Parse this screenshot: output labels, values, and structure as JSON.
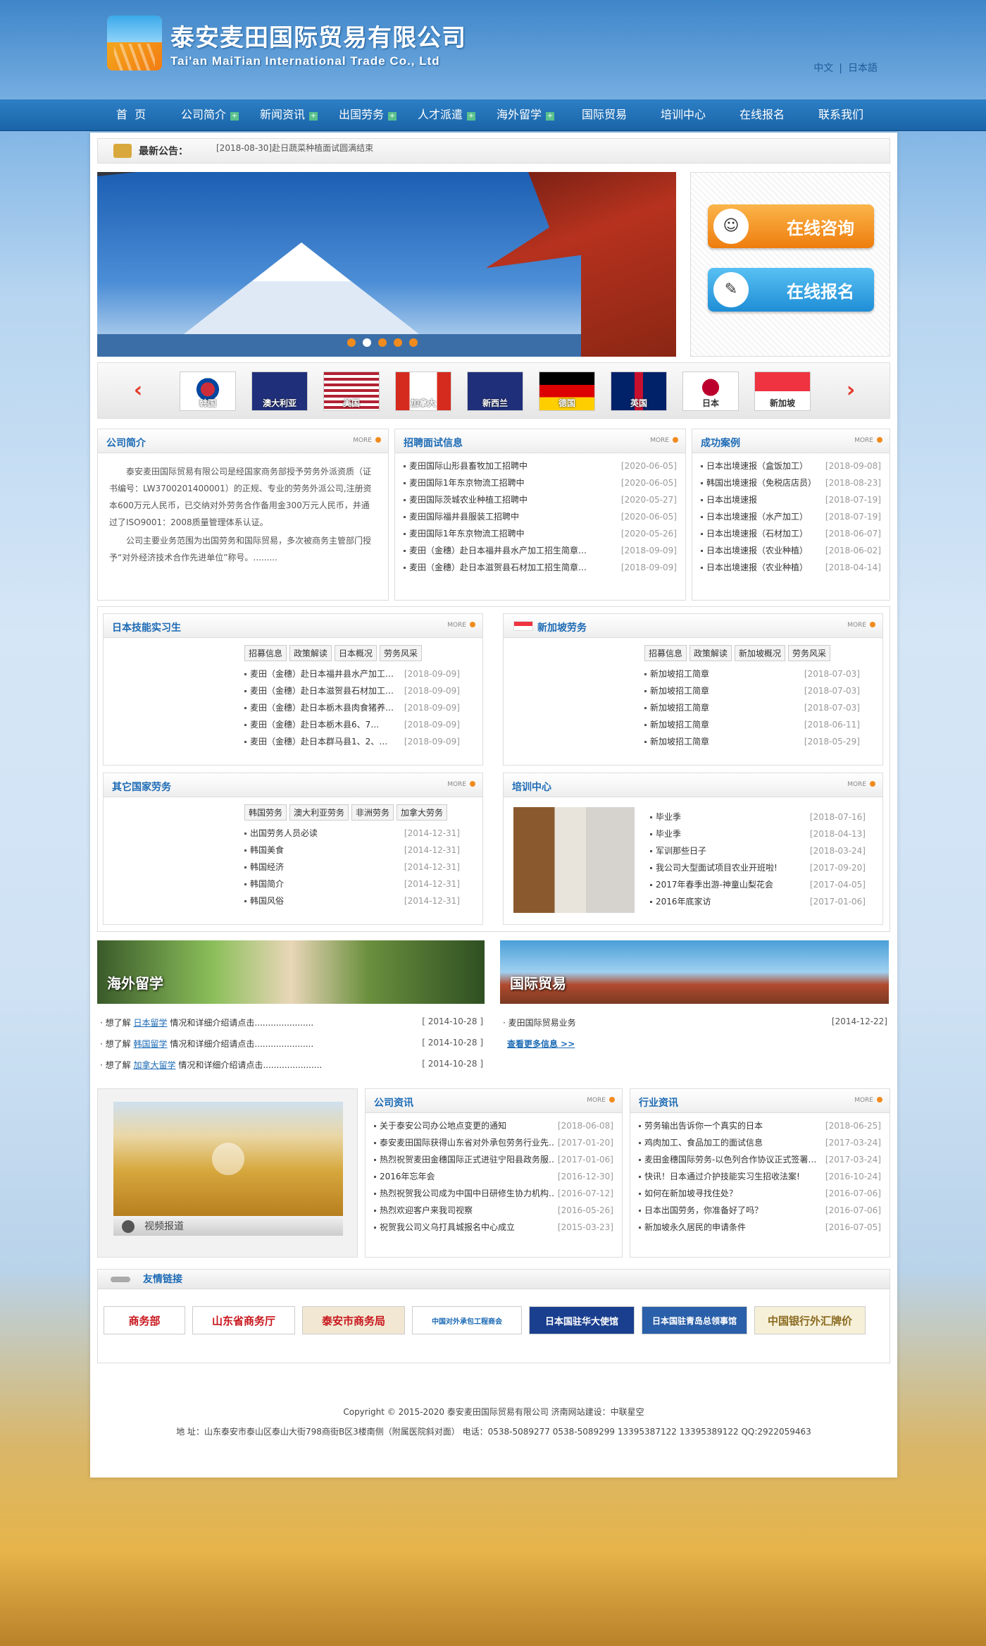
{
  "header": {
    "logo_cn": "泰安麦田国际贸易有限公司",
    "logo_en": "Tai'an MaiTian International Trade Co., Ltd",
    "lang_cn": "中文",
    "lang_sep": "|",
    "lang_jp": "日本語"
  },
  "nav": {
    "items": [
      "首  页",
      "公司简介",
      "新闻资讯",
      "出国劳务",
      "人才派遣",
      "海外留学",
      "国际贸易",
      "培训中心",
      "在线报名",
      "联系我们"
    ]
  },
  "notice": {
    "label": "最新公告：",
    "text": "[2018-08-30]赴日蔬菜种植面试圆满结束"
  },
  "side_buttons": {
    "consult": "在线咨询",
    "signup": "在线报名"
  },
  "flags": [
    "韩国",
    "澳大利亚",
    "美国",
    "加拿大",
    "新西兰",
    "德国",
    "英国",
    "日本",
    "新加坡"
  ],
  "more_label": "MORE",
  "company": {
    "title": "公司简介",
    "p1": "泰安麦田国际贸易有限公司是经国家商务部授予劳务外派资质（证书编号：LW3700201400001）的正规、专业的劳务外派公司,注册资本600万元人民币，已交纳对外劳务合作备用金300万元人民币，并通过了ISO9001：2008质量管理体系认证。",
    "p2": "公司主要业务范围为出国劳务和国际贸易，多次被商务主管部门授予“对外经济技术合作先进单位”称号。........."
  },
  "recruit": {
    "title": "招聘面试信息",
    "items": [
      [
        "麦田国际山形县畜牧加工招聘中",
        "[2020-06-05]"
      ],
      [
        "麦田国际1年东京物流工招聘中",
        "[2020-06-05]"
      ],
      [
        "麦田国际茨城农业种植工招聘中",
        "[2020-05-27]"
      ],
      [
        "麦田国际福井县服装工招聘中",
        "[2020-06-05]"
      ],
      [
        "麦田国际1年东京物流工招聘中",
        "[2020-05-26]"
      ],
      [
        "麦田（金穗）赴日本福井县水产加工招生简章…",
        "[2018-09-09]"
      ],
      [
        "麦田（金穗）赴日本滋贺县石材加工招生简章…",
        "[2018-09-09]"
      ]
    ]
  },
  "cases": {
    "title": "成功案例",
    "items": [
      [
        "日本出境速报（盒饭加工）",
        "[2018-09-08]"
      ],
      [
        "韩国出境速报（免税店店员）",
        "[2018-08-23]"
      ],
      [
        "日本出境速报",
        "[2018-07-19]"
      ],
      [
        "日本出境速报（水产加工）",
        "[2018-07-19]"
      ],
      [
        "日本出境速报（石材加工）",
        "[2018-06-07]"
      ],
      [
        "日本出境速报（农业种植）",
        "[2018-06-02]"
      ],
      [
        "日本出境速报（农业种植）",
        "[2018-04-14]"
      ]
    ]
  },
  "japan": {
    "title": "日本技能实习生",
    "tabs": [
      "招募信息",
      "政策解读",
      "日本概况",
      "劳务风采"
    ],
    "items": [
      [
        "麦田（金穗）赴日本福井县水产加工…",
        "[2018-09-09]"
      ],
      [
        "麦田（金穗）赴日本滋贺县石材加工…",
        "[2018-09-09]"
      ],
      [
        "麦田（金穗）赴日本栃木县肉食猪养…",
        "[2018-09-09]"
      ],
      [
        "麦田（金穗）赴日本栃木县6、7…",
        "[2018-09-09]"
      ],
      [
        "麦田（金穗）赴日本群马县1、2、…",
        "[2018-09-09]"
      ]
    ]
  },
  "singapore": {
    "title": "新加坡劳务",
    "tabs": [
      "招募信息",
      "政策解读",
      "新加坡概况",
      "劳务风采"
    ],
    "items": [
      [
        "新加坡招工简章",
        "[2018-07-03]"
      ],
      [
        "新加坡招工简章",
        "[2018-07-03]"
      ],
      [
        "新加坡招工简章",
        "[2018-07-03]"
      ],
      [
        "新加坡招工简章",
        "[2018-06-11]"
      ],
      [
        "新加坡招工简章",
        "[2018-05-29]"
      ]
    ]
  },
  "other": {
    "title": "其它国家劳务",
    "tabs": [
      "韩国劳务",
      "澳大利亚劳务",
      "非洲劳务",
      "加拿大劳务"
    ],
    "items": [
      [
        "出国劳务人员必读",
        "[2014-12-31]"
      ],
      [
        "韩国美食",
        "[2014-12-31]"
      ],
      [
        "韩国经济",
        "[2014-12-31]"
      ],
      [
        "韩国简介",
        "[2014-12-31]"
      ],
      [
        "韩国风俗",
        "[2014-12-31]"
      ]
    ]
  },
  "training": {
    "title": "培训中心",
    "items": [
      [
        "毕业季",
        "[2018-07-16]"
      ],
      [
        "毕业季",
        "[2018-04-13]"
      ],
      [
        "军训那些日子",
        "[2018-03-24]"
      ],
      [
        "我公司大型面试项目农业开班啦!",
        "[2017-09-20]"
      ],
      [
        "2017年春季出游-神童山梨花会",
        "[2017-04-05]"
      ],
      [
        "2016年底家访",
        "[2017-01-06]"
      ]
    ]
  },
  "study": {
    "banner": "海外留学",
    "lines": [
      {
        "pre": "想了解",
        "link": "日本留学",
        "post": "情况和详细介绍请点击......................",
        "date": "[ 2014-10-28 ]"
      },
      {
        "pre": "想了解",
        "link": "韩国留学",
        "post": "情况和详细介绍请点击......................",
        "date": "[ 2014-10-28 ]"
      },
      {
        "pre": "想了解",
        "link": "加拿大留学",
        "post": "情况和详细介绍请点击......................",
        "date": "[ 2014-10-28 ]"
      }
    ]
  },
  "trade": {
    "banner": "国际贸易",
    "item": "麦田国际贸易业务",
    "date": "[2014-12-22]",
    "more": "查看更多信息 >>"
  },
  "video": {
    "label": "视频报道"
  },
  "news": {
    "title": "公司资讯",
    "items": [
      [
        "关于泰安公司办公地点变更的通知",
        "[2018-06-08]"
      ],
      [
        "泰安麦田国际获得山东省对外承包劳务行业先…",
        "[2017-01-20]"
      ],
      [
        "热烈祝贺麦田金穗国际正式进驻宁阳县政务服…",
        "[2017-01-06]"
      ],
      [
        "2016年忘年会",
        "[2016-12-30]"
      ],
      [
        "热烈祝贺我公司成为中国中日研修生协力机构…",
        "[2016-07-12]"
      ],
      [
        "热烈欢迎客户来我司视察",
        "[2016-05-26]"
      ],
      [
        "祝贺我公司义乌打具城报名中心成立",
        "[2015-03-23]"
      ]
    ]
  },
  "industry": {
    "title": "行业资讯",
    "items": [
      [
        "劳务输出告诉你一个真实的日本",
        "[2018-06-25]"
      ],
      [
        "鸡肉加工、食品加工的面试信息",
        "[2017-03-24]"
      ],
      [
        "麦田金穗国际劳务-以色列合作协议正式签署…",
        "[2017-03-24]"
      ],
      [
        "快讯！日本通过介护技能实习生招收法案!",
        "[2016-10-24]"
      ],
      [
        "如何在新加坡寻找住处？",
        "[2016-07-06]"
      ],
      [
        "日本出国劳务，你准备好了吗？",
        "[2016-07-06]"
      ],
      [
        "新加坡永久居民的申请条件",
        "[2016-07-05]"
      ]
    ]
  },
  "links": {
    "title": "友情链接",
    "items": [
      "商务部",
      "山东省商务厅",
      "泰安市商务局",
      "中国对外承包工程商会",
      "日本国驻华大使馆",
      "日本国驻青岛总领事馆",
      "中国银行外汇牌价"
    ]
  },
  "footer": {
    "line1": "Copyright © 2015-2020  泰安麦田国际贸易有限公司  济南网站建设：中联星空",
    "line2": "地 址：山东泰安市泰山区泰山大街798商街B区3楼南侧（附属医院斜对面） 电话：0538-5089277 0538-5089299 13395387122 13395389122 QQ:2922059463"
  }
}
